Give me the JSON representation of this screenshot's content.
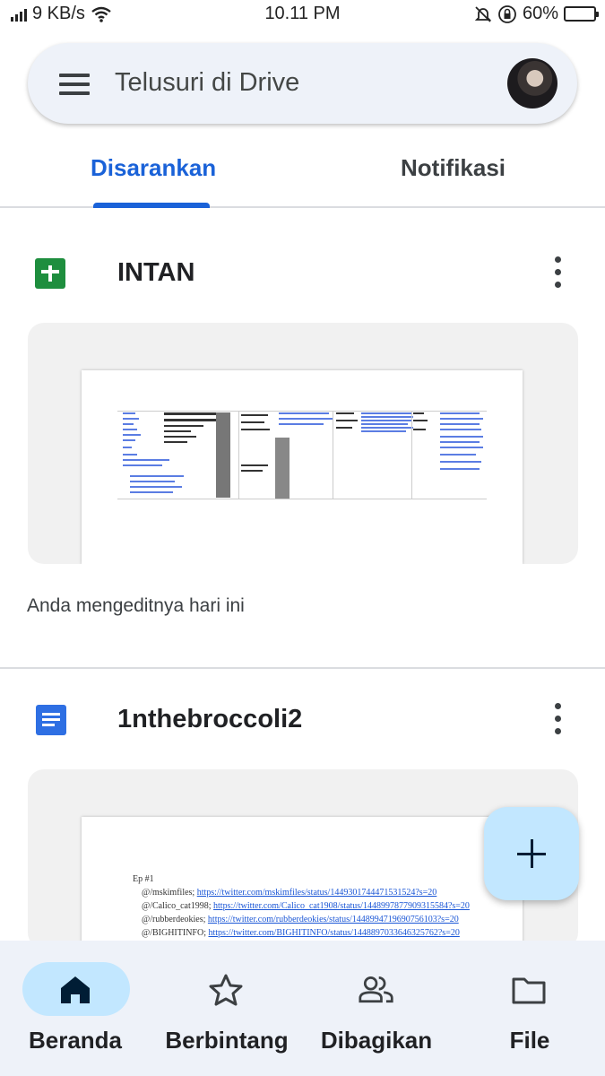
{
  "status_bar": {
    "speed": "9 KB/s",
    "time": "10.11 PM",
    "battery": "60%",
    "battery_level": 0.6
  },
  "search": {
    "placeholder": "Telusuri di Drive",
    "menu_icon": "hamburger-menu-icon",
    "avatar": "account-avatar"
  },
  "tabs": [
    {
      "label": "Disarankan",
      "active": true
    },
    {
      "label": "Notifikasi",
      "active": false
    }
  ],
  "files": [
    {
      "name": "INTAN",
      "type_icon": "google-sheets-icon",
      "note": "Anda mengeditnya hari ini"
    },
    {
      "name": "1nthebroccoli2",
      "type_icon": "google-docs-icon",
      "preview": {
        "heading": "Ep #1",
        "lines": [
          {
            "prefix": "@/mskimfiles; ",
            "link": "https://twitter.com/mskimfiles/status/1449301744471531524?s=20"
          },
          {
            "prefix": "@/Calico_cat1998; ",
            "link": "https://twitter.com/Calico_cat1908/status/1448997877909315584?s=20"
          },
          {
            "prefix": "@/rubberdeokies; ",
            "link": "https://twitter.com/rubberdeokies/status/1448994719690756103?s=20"
          },
          {
            "prefix": "@/BIGHITINFO; ",
            "link": "https://twitter.com/BIGHITINFO/status/1448897033646325762?s=20"
          }
        ]
      }
    }
  ],
  "fab": {
    "icon": "plus-icon"
  },
  "bottom_nav": [
    {
      "label": "Beranda",
      "icon": "home-icon",
      "active": true
    },
    {
      "label": "Berbintang",
      "icon": "star-icon",
      "active": false
    },
    {
      "label": "Dibagikan",
      "icon": "people-icon",
      "active": false
    },
    {
      "label": "File",
      "icon": "folder-icon",
      "active": false
    }
  ],
  "colors": {
    "accent": "#1a62d8",
    "surface": "#eef2f9",
    "fab": "#c2e7ff",
    "sheets": "#1e8e3e",
    "docs": "#2e6fe3"
  }
}
